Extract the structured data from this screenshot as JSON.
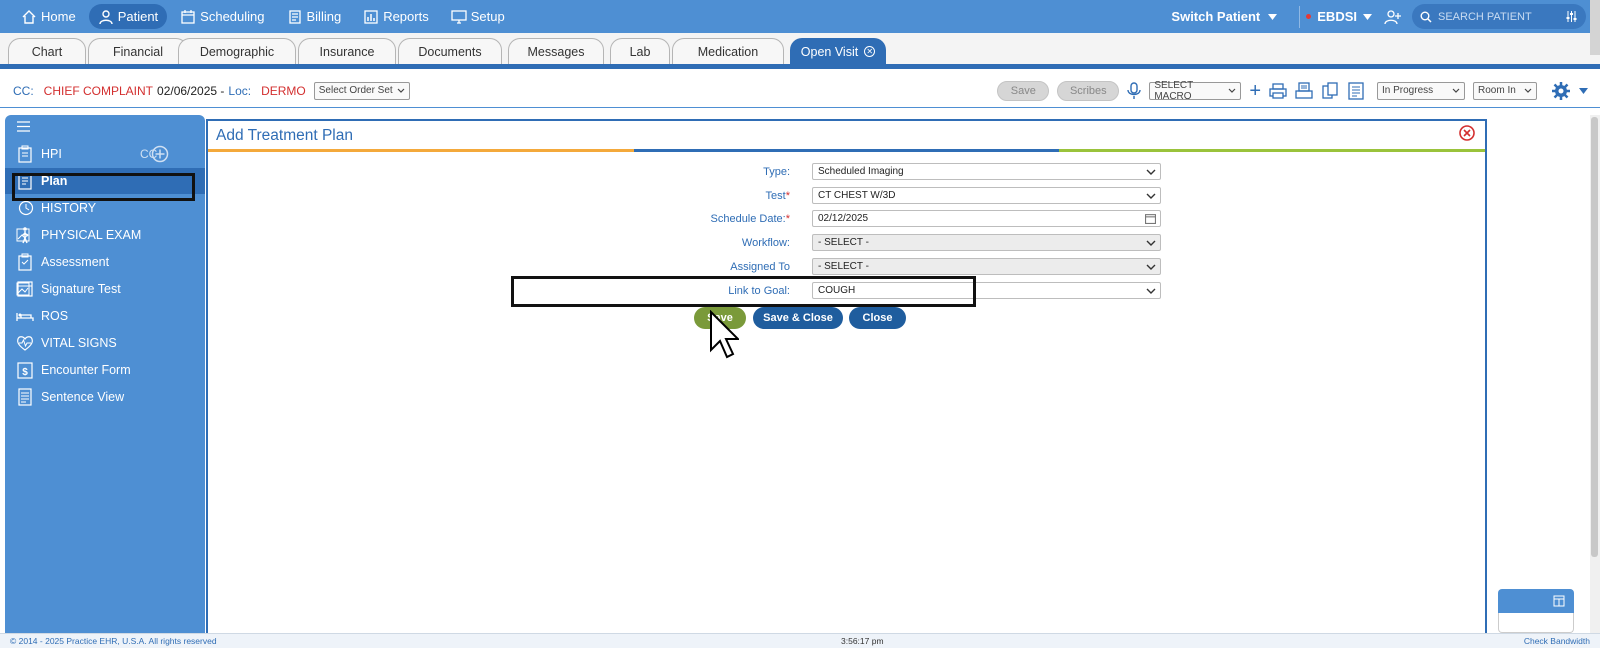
{
  "nav": {
    "items": [
      {
        "label": "Home",
        "icon": "home-icon"
      },
      {
        "label": "Patient",
        "icon": "user-icon"
      },
      {
        "label": "Scheduling",
        "icon": "calendar-icon"
      },
      {
        "label": "Billing",
        "icon": "billing-icon"
      },
      {
        "label": "Reports",
        "icon": "reports-icon"
      },
      {
        "label": "Setup",
        "icon": "monitor-icon"
      }
    ],
    "switch_patient": "Switch Patient",
    "account": "EBDSI",
    "search_placeholder": "SEARCH PATIENT"
  },
  "tabs": [
    "Chart",
    "Financial",
    "Demographic",
    "Insurance",
    "Documents",
    "Messages",
    "Lab",
    "Medication",
    "Open Visit"
  ],
  "cc_bar": {
    "cc_label": "CC:",
    "complaint": "CHIEF COMPLAINT",
    "date": "02/06/2025 -",
    "loc_label": "Loc:",
    "loc": "DERMO",
    "order_set": "Select Order Set",
    "save": "Save",
    "scribes": "Scribes",
    "macro": "SELECT MACRO",
    "status": "In Progress",
    "room": "Room In"
  },
  "sidebar": {
    "items": [
      {
        "label": "HPI",
        "extra": "CC"
      },
      {
        "label": "Plan"
      },
      {
        "label": "HISTORY"
      },
      {
        "label": "PHYSICAL EXAM"
      },
      {
        "label": "Assessment"
      },
      {
        "label": "Signature Test"
      },
      {
        "label": "ROS"
      },
      {
        "label": "VITAL SIGNS"
      },
      {
        "label": "Encounter Form"
      },
      {
        "label": "Sentence View"
      }
    ]
  },
  "dialog": {
    "title": "Add Treatment Plan",
    "fields": {
      "type": {
        "label": "Type:",
        "value": "Scheduled Imaging"
      },
      "test": {
        "label": "Test",
        "value": "CT CHEST W/3D"
      },
      "schedule_date": {
        "label": "Schedule Date:",
        "value": "02/12/2025"
      },
      "workflow": {
        "label": "Workflow:",
        "value": "- SELECT -"
      },
      "assigned_to": {
        "label": "Assigned To",
        "value": "- SELECT -"
      },
      "link_to_goal": {
        "label": "Link to Goal:",
        "value": "COUGH"
      }
    },
    "buttons": {
      "save": "Save",
      "save_close": "Save & Close",
      "close": "Close"
    }
  },
  "footer": {
    "copyright": "© 2014 - 2025 Practice EHR, U.S.A. All rights reserved",
    "time": "3:56:17 pm",
    "bandwidth": "Check Bandwidth"
  },
  "colors": {
    "primary": "#4e8fd3",
    "dark_primary": "#2f6db5",
    "save_green": "#7a9a3a",
    "danger": "#d32f2f"
  }
}
